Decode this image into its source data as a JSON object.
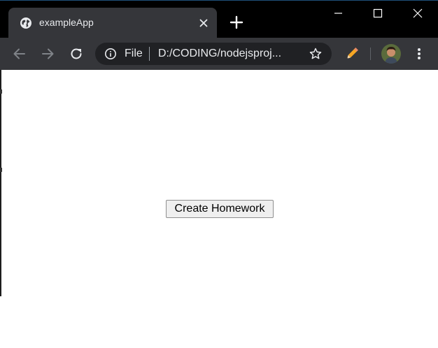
{
  "browser": {
    "tab": {
      "title": "exampleApp",
      "favicon": "globe-icon",
      "close_icon": "close-icon"
    },
    "new_tab_icon": "plus-icon",
    "window_controls": {
      "minimize": "minimize-icon",
      "maximize": "maximize-icon",
      "close": "close-icon"
    },
    "toolbar": {
      "back_icon": "arrow-left-icon",
      "forward_icon": "arrow-right-icon",
      "reload_icon": "reload-icon",
      "omnibox": {
        "info_icon": "info-icon",
        "scheme_label": "File",
        "url": "D:/CODING/nodejsproj...",
        "star_icon": "star-icon"
      },
      "extension_icon": "pencil-icon",
      "menu_icon": "kebab-menu-icon"
    },
    "colors": {
      "tabstrip_bg": "#000000",
      "tab_bg": "#35363a",
      "toolbar_bg": "#35363a",
      "omnibox_bg": "#202124",
      "text": "#e8eaed",
      "extension_accent": "#f6a623"
    }
  },
  "page": {
    "create_button_label": "Create Homework"
  }
}
